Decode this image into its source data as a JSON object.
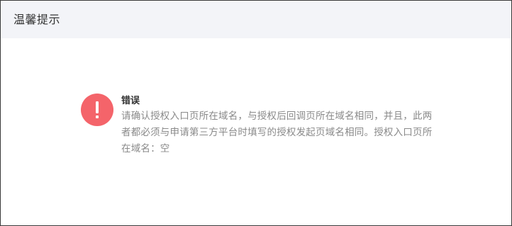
{
  "dialog": {
    "title": "温馨提示"
  },
  "message": {
    "icon": "exclamation-icon",
    "icon_color": "#f4646a",
    "title": "错误",
    "body": "请确认授权入口页所在域名，与授权后回调页所在域名相同，并且，此两者都必须与申请第三方平台时填写的授权发起页域名相同。授权入口页所在域名：空"
  }
}
